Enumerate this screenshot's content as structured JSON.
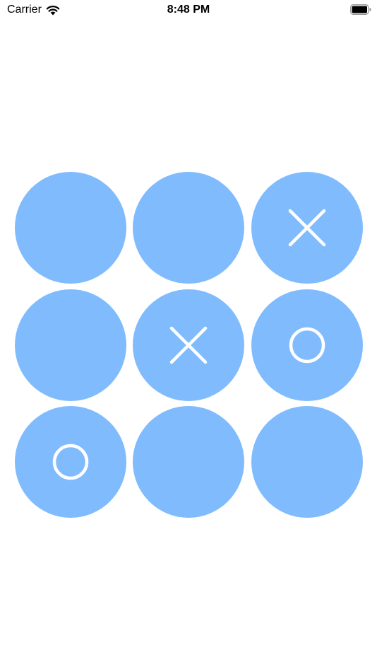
{
  "status_bar": {
    "carrier": "Carrier",
    "time": "8:48 PM",
    "icons": [
      "wifi-icon",
      "battery-icon"
    ]
  },
  "colors": {
    "cell_fill": "#80bcfd",
    "mark_stroke": "#ffffff",
    "background": "#ffffff"
  },
  "board": {
    "cells": [
      "",
      "",
      "X",
      "",
      "X",
      "O",
      "O",
      "",
      ""
    ]
  }
}
